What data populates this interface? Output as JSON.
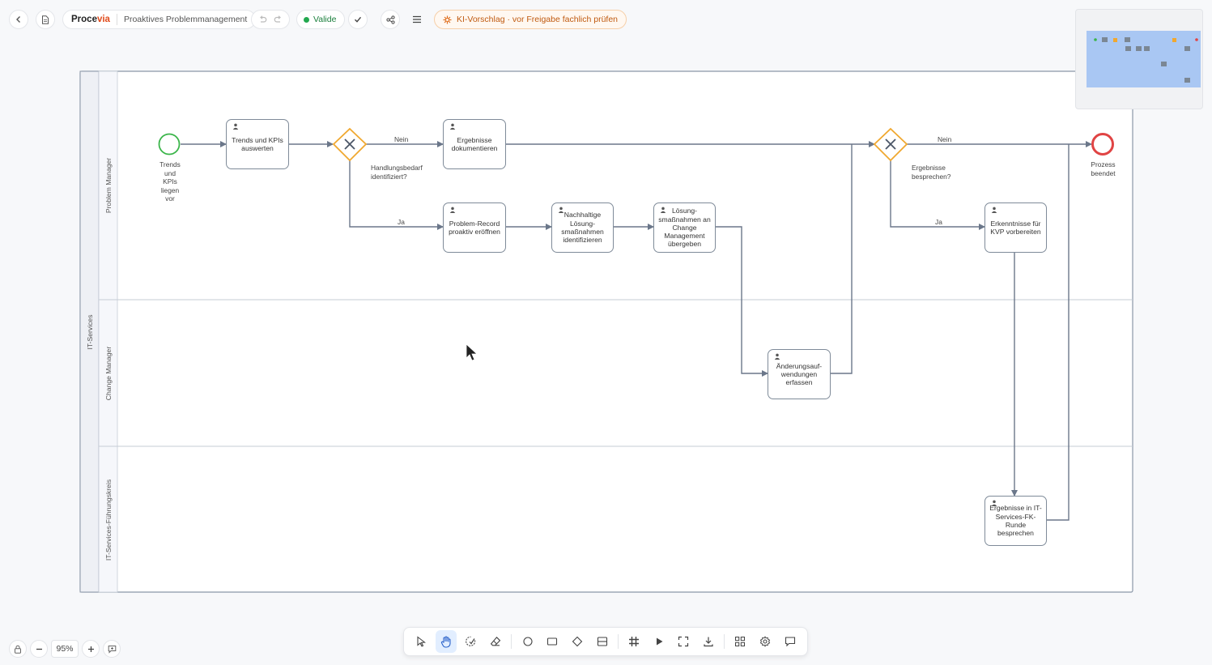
{
  "header": {
    "brand_main": "Proce",
    "brand_accent": "via",
    "document_title": "Proaktives Problemmanagement",
    "status": "Valide",
    "ai_notice": "KI-Vorschlag · vor Freigabe fachlich prüfen"
  },
  "colors": {
    "accent": "#e04a1a",
    "valid": "#22a84f",
    "gateway": "#f0a830",
    "start": "#3bb54a",
    "end": "#e04444",
    "flow": "#6b778a"
  },
  "pool": {
    "name": "IT-Services"
  },
  "lanes": [
    {
      "name": "Problem Manager"
    },
    {
      "name": "Change Manager"
    },
    {
      "name": "IT-Services-Führungskreis"
    }
  ],
  "events": {
    "start": {
      "label": "Trends und KPIs liegen vor"
    },
    "end": {
      "label": "Prozess beendet"
    }
  },
  "tasks": {
    "t1": "Trends und KPIs auswerten",
    "t2": "Ergebnisse dokumentieren",
    "t3": "Problem-Record proaktiv eröffnen",
    "t4": "Nachhaltige Lösung-smaßnahmen identifizieren",
    "t5": "Lösung-smaßnahmen an Change Management übergeben",
    "t6": "Änderungsauf-wendungen erfassen",
    "t7": "Erkenntnisse für KVP vorbereiten",
    "t8": "Ergebnisse in IT-Services-FK-Runde besprechen"
  },
  "gateways": {
    "g1": "Handlungsbedarf identifiziert?",
    "g2": "Ergebnisse besprechen?"
  },
  "flow_labels": {
    "g1_no": "Nein",
    "g1_yes": "Ja",
    "g2_no": "Nein",
    "g2_yes": "Ja"
  },
  "zoom": {
    "level": "95%"
  },
  "toolbar_tools": [
    "select",
    "hand",
    "lasso",
    "eraser",
    "start-event",
    "task",
    "gateway",
    "lane",
    "grid",
    "simulate",
    "fit",
    "download",
    "apps",
    "settings",
    "comments"
  ],
  "toolbar_active": "hand"
}
